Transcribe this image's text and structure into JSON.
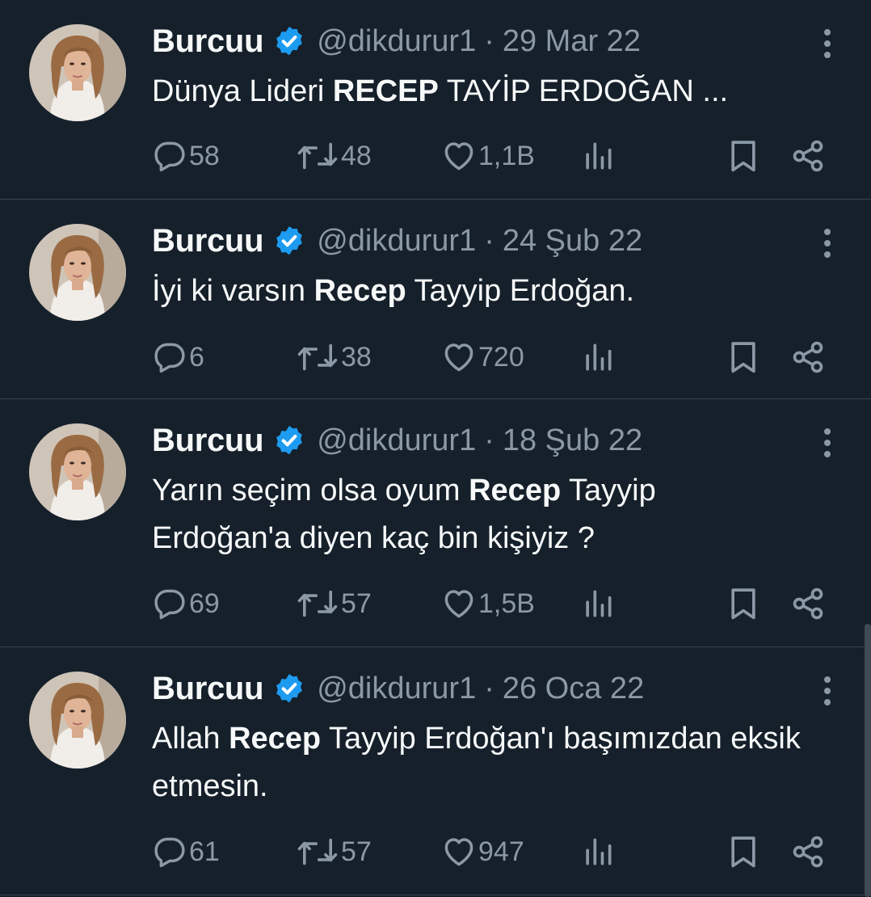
{
  "accent": "#1d9bf0",
  "tweets": [
    {
      "name": "Burcuu",
      "handle": "@dikdurur1",
      "separator": "·",
      "date": "29 Mar 22",
      "text_parts": [
        {
          "t": "Dünya Lideri ",
          "bold": false
        },
        {
          "t": "RECEP",
          "bold": true
        },
        {
          "t": " TAYİP ERDOĞAN ...",
          "bold": false
        }
      ],
      "replies": "58",
      "retweets": "48",
      "likes": "1,1B"
    },
    {
      "name": "Burcuu",
      "handle": "@dikdurur1",
      "separator": "·",
      "date": "24 Şub 22",
      "text_parts": [
        {
          "t": "İyi ki varsın ",
          "bold": false
        },
        {
          "t": "Recep",
          "bold": true
        },
        {
          "t": " Tayyip Erdoğan.",
          "bold": false
        }
      ],
      "replies": "6",
      "retweets": "38",
      "likes": "720"
    },
    {
      "name": "Burcuu",
      "handle": "@dikdurur1",
      "separator": "·",
      "date": "18 Şub 22",
      "text_parts": [
        {
          "t": "Yarın seçim olsa oyum ",
          "bold": false
        },
        {
          "t": "Recep",
          "bold": true
        },
        {
          "t": " Tayyip Erdoğan'a diyen kaç bin kişiyiz ?",
          "bold": false
        }
      ],
      "replies": "69",
      "retweets": "57",
      "likes": "1,5B"
    },
    {
      "name": "Burcuu",
      "handle": "@dikdurur1",
      "separator": "·",
      "date": "26 Oca 22",
      "text_parts": [
        {
          "t": "Allah ",
          "bold": false
        },
        {
          "t": "Recep",
          "bold": true
        },
        {
          "t": " Tayyip Erdoğan'ı başımızdan eksik etmesin.",
          "bold": false
        }
      ],
      "replies": "61",
      "retweets": "57",
      "likes": "947"
    }
  ]
}
